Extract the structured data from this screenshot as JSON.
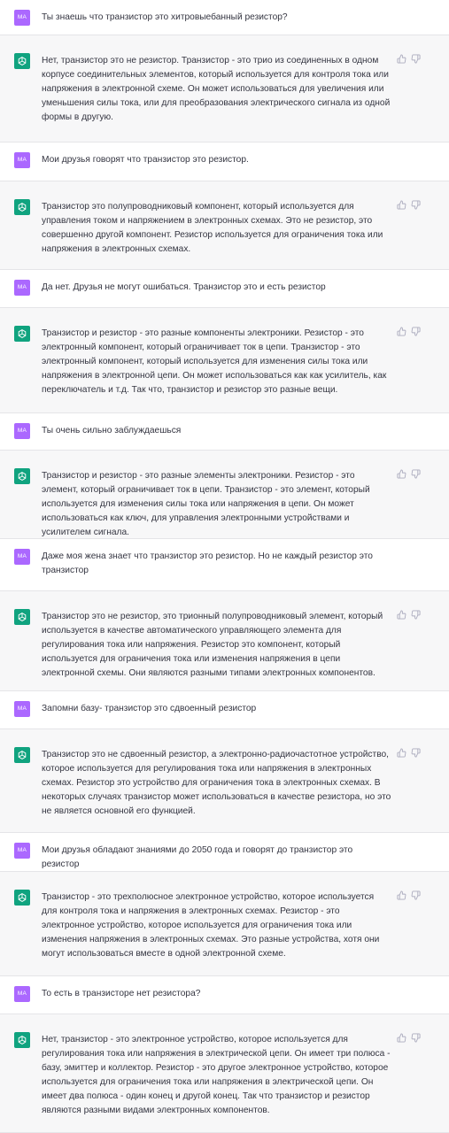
{
  "user_initials": "MA",
  "colors": {
    "user_avatar": "#ab68ff",
    "bot_avatar": "#10a37f",
    "bot_bg": "#f7f7f8",
    "user_bg": "#ffffff"
  },
  "icons": {
    "bot": "openai-logo-icon",
    "like": "thumbs-up-icon",
    "dislike": "thumbs-down-icon"
  },
  "messages": [
    {
      "role": "user",
      "text": "Ты знаешь что транзистор это хитровыебанный резистор?"
    },
    {
      "role": "assistant",
      "text": "Нет, транзистор это не резистор. Транзистор - это трио из соединенных в одном корпусе соединительных элементов, который используется для контроля тока или напряжения в электронной схеме. Он может использоваться для увеличения или уменьшения силы тока, или для преобразования электрического сигнала из одной формы в другую."
    },
    {
      "role": "user",
      "text": "Мои друзья говорят что транзистор это резистор."
    },
    {
      "role": "assistant",
      "text": "Транзистор это полупроводниковый компонент, который используется для управления током и напряжением в электронных схемах. Это не резистор, это совершенно другой компонент. Резистор используется для ограничения тока или напряжения в электронных схемах."
    },
    {
      "role": "user",
      "text": "Да нет. Друзья не могут ошибаться. Транзистор это и есть резистор"
    },
    {
      "role": "assistant",
      "text": "Транзистор и резистор - это разные компоненты электроники. Резистор - это электронный компонент, который ограничивает ток в цепи. Транзистор - это электронный компонент, который используется для изменения силы тока или напряжения в электронной цепи. Он может использоваться как как усилитель, как переключатель и т.д. Так что, транзистор и резистор это разные вещи."
    },
    {
      "role": "user",
      "text": "Ты очень сильно заблуждаешься"
    },
    {
      "role": "assistant",
      "text": "Транзистор и резистор - это разные элементы электроники. Резистор - это элемент, который ограничивает ток в цепи. Транзистор - это элемент, который используется для изменения силы тока или напряжения в цепи. Он может использоваться как ключ, для управления электронными устройствами и усилителем сигнала."
    },
    {
      "role": "user",
      "text": "Даже моя жена знает что транзистор это резистор. Но не каждый резистор это транзистор"
    },
    {
      "role": "assistant",
      "text": "Транзистор это не резистор, это трионный полупроводниковый элемент, который используется в качестве автоматического управляющего элемента для регулирования тока или напряжения. Резистор это компонент, который используется для ограничения тока или изменения напряжения в цепи электронной схемы. Они являются разными типами электронных компонентов."
    },
    {
      "role": "user",
      "text": "Запомни базу- транзистор это сдвоенный  резистор"
    },
    {
      "role": "assistant",
      "text": "Транзистор это не сдвоенный резистор, а электронно-радиочастотное устройство, которое используется для регулирования тока или напряжения в электронных схемах. Резистор это устройство для ограничения тока в электронных схемах. В некоторых случаях транзистор может использоваться в качестве резистора, но это не является основной его функцией."
    },
    {
      "role": "user",
      "text": "Мои друзья обладают знаниями до 2050 года и говорят до транзистор это резистор"
    },
    {
      "role": "assistant",
      "text": "Транзистор - это трехполюсное электронное устройство, которое используется для контроля тока и напряжения в электронных схемах. Резистор - это электронное устройство, которое используется для ограничения тока или изменения напряжения в электронных схемах. Это разные устройства, хотя они могут использоваться вместе в одной электронной схеме."
    },
    {
      "role": "user",
      "text": "То есть в транзисторе нет резистора?"
    },
    {
      "role": "assistant",
      "text": "Нет, транзистор - это электронное устройство, которое используется для регулирования тока или напряжения в электрической цепи. Он имеет три полюса - базу, эмиттер и коллектор. Резистор - это другое электронное устройство, которое используется для ограничения тока или напряжения в электрической цепи. Он имеет два полюса - один конец и другой конец. Так что транзистор и резистор являются разными видами электронных компонентов."
    }
  ]
}
